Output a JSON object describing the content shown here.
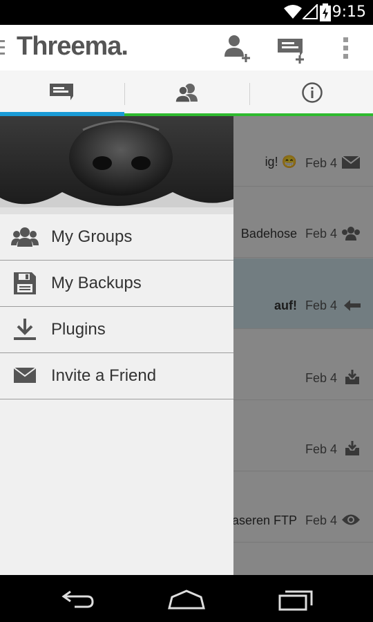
{
  "status_bar": {
    "time": "9:15"
  },
  "app_bar": {
    "title": "Threema.",
    "actions": [
      "add-contact-icon",
      "new-message-icon",
      "overflow-menu-icon"
    ]
  },
  "tabs": [
    {
      "name": "conversations",
      "icon": "message-icon",
      "active": true
    },
    {
      "name": "contacts",
      "icon": "contacts-icon",
      "active": false
    },
    {
      "name": "info",
      "icon": "info-icon",
      "active": false
    }
  ],
  "conversations": [
    {
      "preview": "ig! 😁",
      "date": "Feb 4",
      "icon": "envelope-icon"
    },
    {
      "preview": "Badehose",
      "date": "Feb 4",
      "icon": "group-icon"
    },
    {
      "preview": "auf!",
      "date": "Feb 4",
      "icon": "reply-arrow-icon"
    },
    {
      "preview": "",
      "date": "Feb 4",
      "icon": "inbox-download-icon"
    },
    {
      "preview": "",
      "date": "Feb 4",
      "icon": "inbox-download-icon"
    },
    {
      "preview": "aseren FTP",
      "date": "Feb 4",
      "icon": "eye-icon"
    }
  ],
  "drawer": {
    "items": [
      {
        "label": "My Groups",
        "icon": "groups-icon"
      },
      {
        "label": "My Backups",
        "icon": "floppy-disk-icon"
      },
      {
        "label": "Plugins",
        "icon": "download-icon"
      },
      {
        "label": "Invite a Friend",
        "icon": "envelope-icon"
      }
    ]
  },
  "colors": {
    "accent_blue": "#1a9bd6",
    "accent_green": "#2fba2f",
    "selected_row": "#cfe4ec"
  }
}
